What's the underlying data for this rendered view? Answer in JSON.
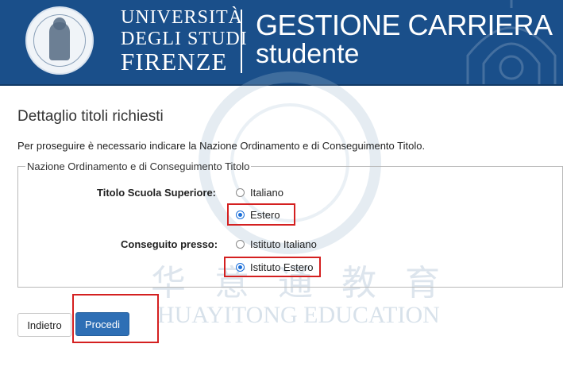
{
  "header": {
    "university_line1": "UNIVERSITÀ",
    "university_line2": "DEGLI STUDI",
    "university_line3": "FIRENZE",
    "app_title_line1": "GESTIONE CARRIERA",
    "app_title_line2": "studente",
    "background_color": "#1a4f8a",
    "seal_icon": "university-seal-icon"
  },
  "page": {
    "title": "Dettaglio titoli richiesti",
    "instructions": "Per proseguire è necessario indicare la Nazione Ordinamento e di Conseguimento Titolo."
  },
  "form": {
    "legend": "Nazione Ordinamento e di Conseguimento Titolo",
    "titolo": {
      "label": "Titolo Scuola Superiore:",
      "options": [
        "Italiano",
        "Estero"
      ],
      "selected": "Estero"
    },
    "conseguito": {
      "label": "Conseguito presso:",
      "options": [
        "Istituto Italiano",
        "Istituto Estero"
      ],
      "selected": "Istituto Estero"
    }
  },
  "buttons": {
    "back": "Indietro",
    "next": "Procedi"
  },
  "watermark": {
    "chinese": "华意通教育",
    "english": "HUAYITONG EDUCATION"
  },
  "colors": {
    "accent": "#2e6fb5",
    "highlight": "#d42020",
    "radio_selected": "#1a6ed8"
  }
}
